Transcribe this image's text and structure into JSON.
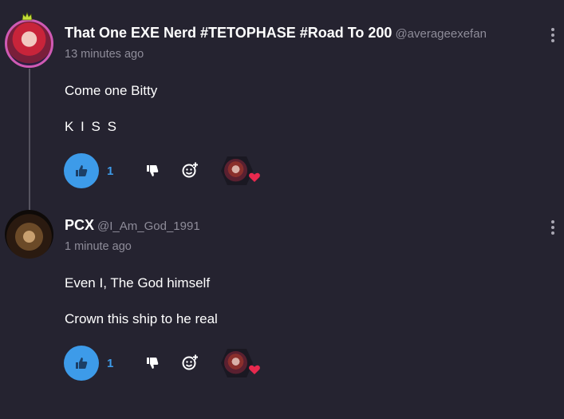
{
  "comments": [
    {
      "author": "That One EXE Nerd #TETOPHASE #Road To 200",
      "handle": "@averageexefan",
      "time": "13 minutes ago",
      "paragraphs": [
        "Come one Bitty",
        "K I S S"
      ],
      "likes": "1"
    },
    {
      "author": "PCX",
      "handle": "@I_Am_God_1991",
      "time": "1 minute ago",
      "paragraphs": [
        "Even I, The God himself",
        "Crown this ship to he real"
      ],
      "likes": "1"
    }
  ],
  "colors": {
    "background": "#252330",
    "accent": "#3d9be9",
    "muted_text": "#8e8c99",
    "heart": "#e8294e"
  },
  "icons": {
    "like": "thumbs-up-icon",
    "dislike": "thumbs-down-icon",
    "react": "add-reaction-icon",
    "more": "more-vertical-icon",
    "reaction_heart": "heart-icon"
  }
}
